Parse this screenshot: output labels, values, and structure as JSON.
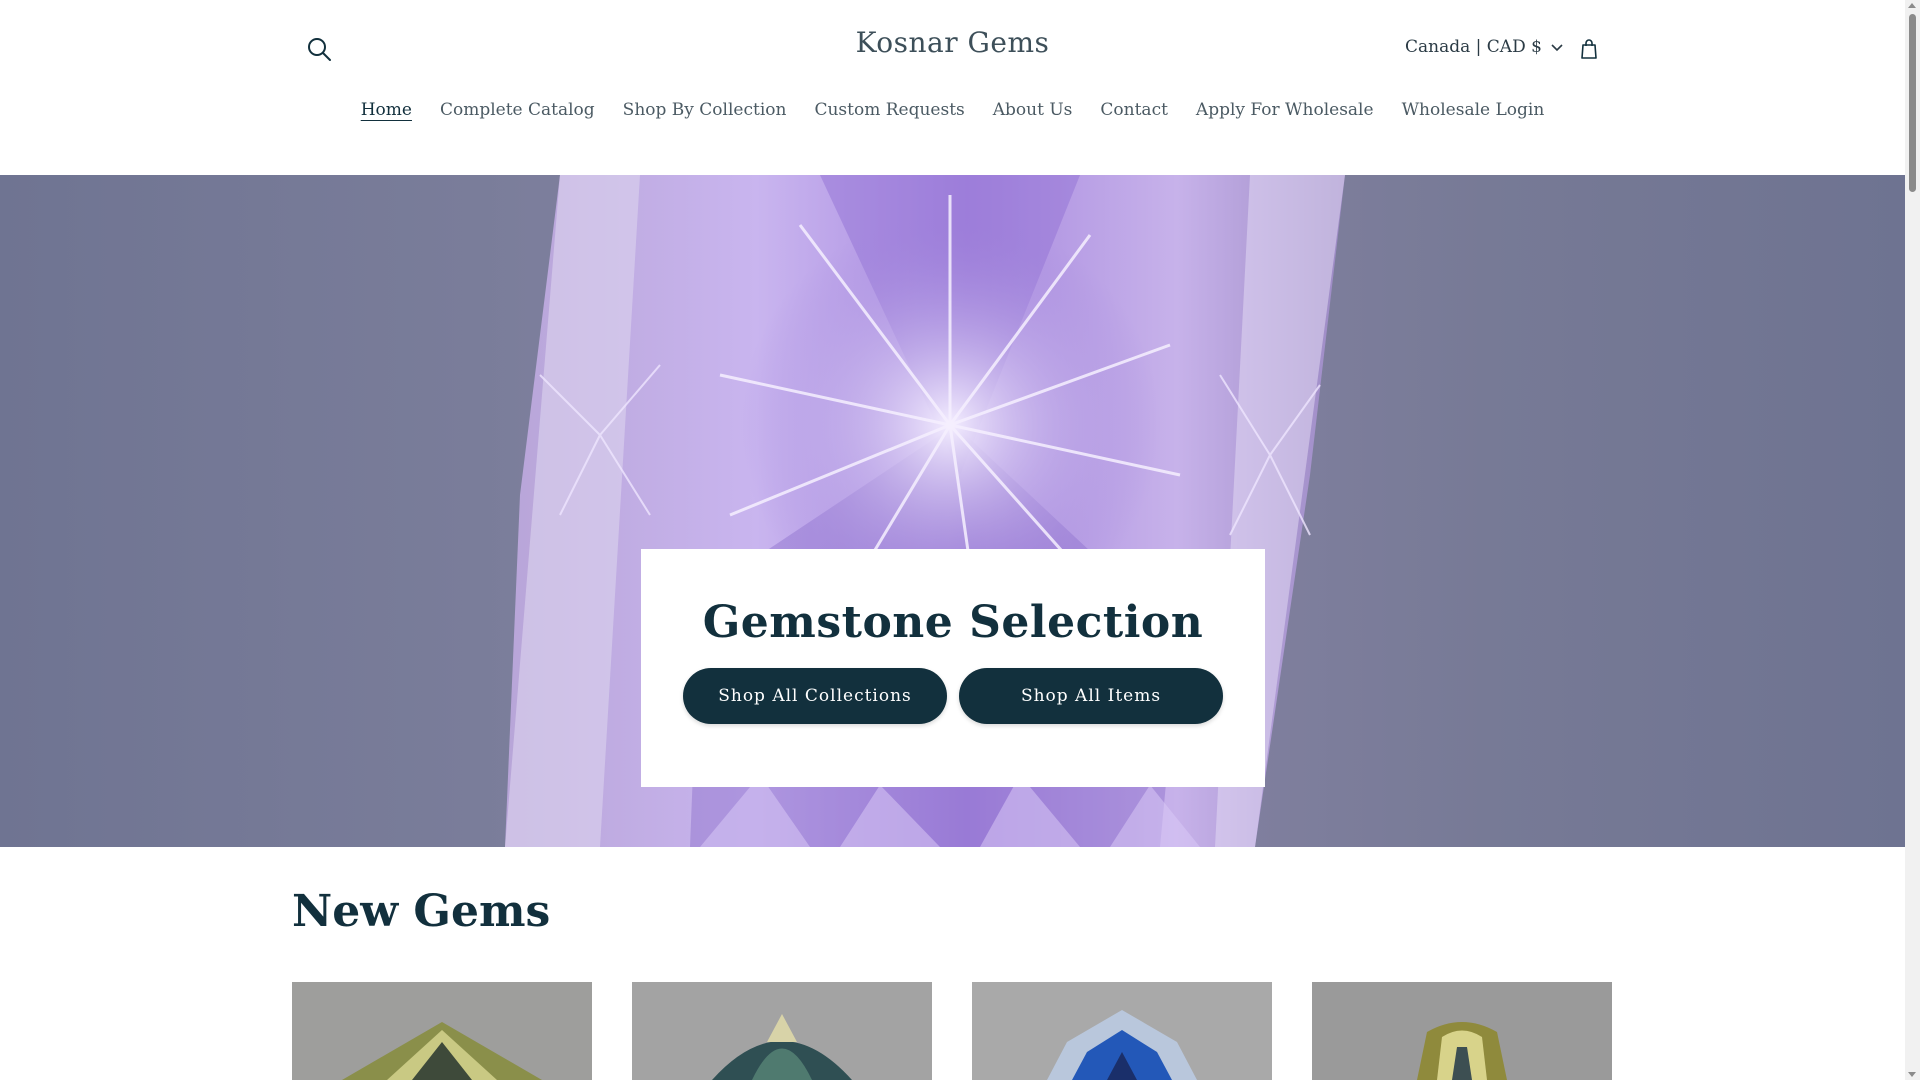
{
  "header": {
    "brand": "Kosnar Gems",
    "search_icon": "search-icon",
    "locale_label": "Canada | CAD $",
    "locale_icon": "chevron-down-icon",
    "cart_icon": "cart-icon"
  },
  "nav": {
    "items": [
      {
        "label": "Home",
        "active": true
      },
      {
        "label": "Complete Catalog"
      },
      {
        "label": "Shop By Collection"
      },
      {
        "label": "Custom Requests"
      },
      {
        "label": "About Us"
      },
      {
        "label": "Contact"
      },
      {
        "label": "Apply For Wholesale"
      },
      {
        "label": "Wholesale Login"
      }
    ]
  },
  "hero": {
    "title": "Gemstone Selection",
    "buttons": {
      "collections": "Shop All Collections",
      "items": "Shop All Items"
    }
  },
  "new_gems": {
    "title": "New Gems"
  },
  "colors": {
    "primary": "#12303d",
    "hero_purple": "#a98be0"
  }
}
